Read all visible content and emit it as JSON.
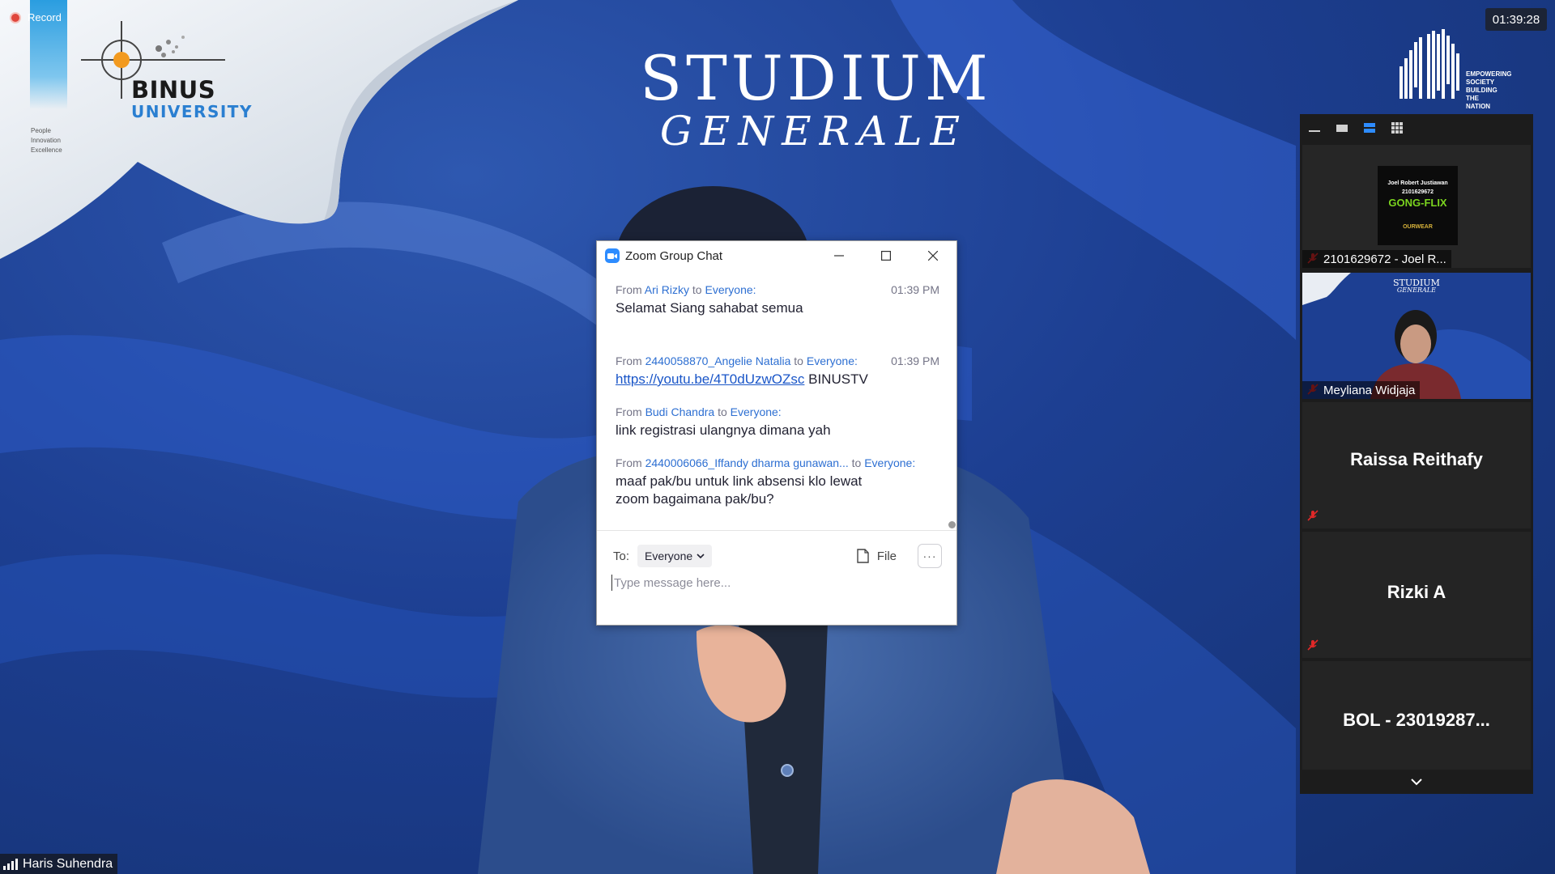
{
  "recording": {
    "label": "Record"
  },
  "branding": {
    "binus_name": "BINUS",
    "binus_sub": "UNIVERSITY",
    "binus_tagline": [
      "People",
      "Innovation",
      "Excellence"
    ],
    "event_title_line1": "STUDIUM",
    "event_title_line2": "GENERALE",
    "anniversary_text": [
      "EMPOWERING",
      "SOCIETY",
      "BUILDING",
      "THE",
      "NATION"
    ]
  },
  "clock": "01:39:28",
  "speaker_label": "Haris Suhendra",
  "chat": {
    "title": "Zoom Group Chat",
    "messages": [
      {
        "from_prefix": "From",
        "sender": "Ari Rizky",
        "to_word": "to",
        "recipient": "Everyone:",
        "time": "01:39 PM",
        "text": "Selamat Siang sahabat semua"
      },
      {
        "from_prefix": "From",
        "sender": "2440058870_Angelie Natalia",
        "to_word": "to",
        "recipient": "Everyone:",
        "time": "01:39 PM",
        "link": "https://youtu.be/4T0dUzwOZsc",
        "text": "BINUSTV"
      },
      {
        "from_prefix": "From",
        "sender": "Budi Chandra",
        "to_word": "to",
        "recipient": "Everyone:",
        "time": "",
        "text": "link registrasi ulangnya dimana yah"
      },
      {
        "from_prefix": "From",
        "sender": "2440006066_Iffandy dharma gunawan...",
        "to_word": "to",
        "recipient": "Everyone:",
        "time": "",
        "text_line1": "maaf pak/bu untuk link absensi klo lewat",
        "text_line2": "zoom bagaimana pak/bu?"
      }
    ],
    "to_label": "To:",
    "to_value": "Everyone",
    "file_label": "File",
    "more_label": "···",
    "input_placeholder": "Type message here..."
  },
  "participants": [
    {
      "name": "2101629672 - Joel R...",
      "type": "video",
      "thumb_lines": [
        "Joel Robert Justiawan",
        "2101629672",
        "GONG-FLIX",
        "OURWEAR"
      ]
    },
    {
      "name": "Meyliana Widjaja",
      "type": "video",
      "thumb_lines": [
        "STUDIUM",
        "GENERALE"
      ]
    },
    {
      "name": "Raissa Reithafy",
      "type": "name"
    },
    {
      "name": "Rizki A",
      "type": "name"
    },
    {
      "name": "BOL - 23019287...",
      "type": "name"
    }
  ],
  "colors": {
    "zoom_blue": "#2d8cff",
    "link_blue": "#2d6fd2",
    "mic_muted_red": "#e02828"
  },
  "icons": {
    "panel_top": [
      "minimize-icon",
      "speaker-view-icon",
      "strip-view-icon",
      "grid-view-icon"
    ],
    "panel_bottom": "chevron-down-icon"
  }
}
